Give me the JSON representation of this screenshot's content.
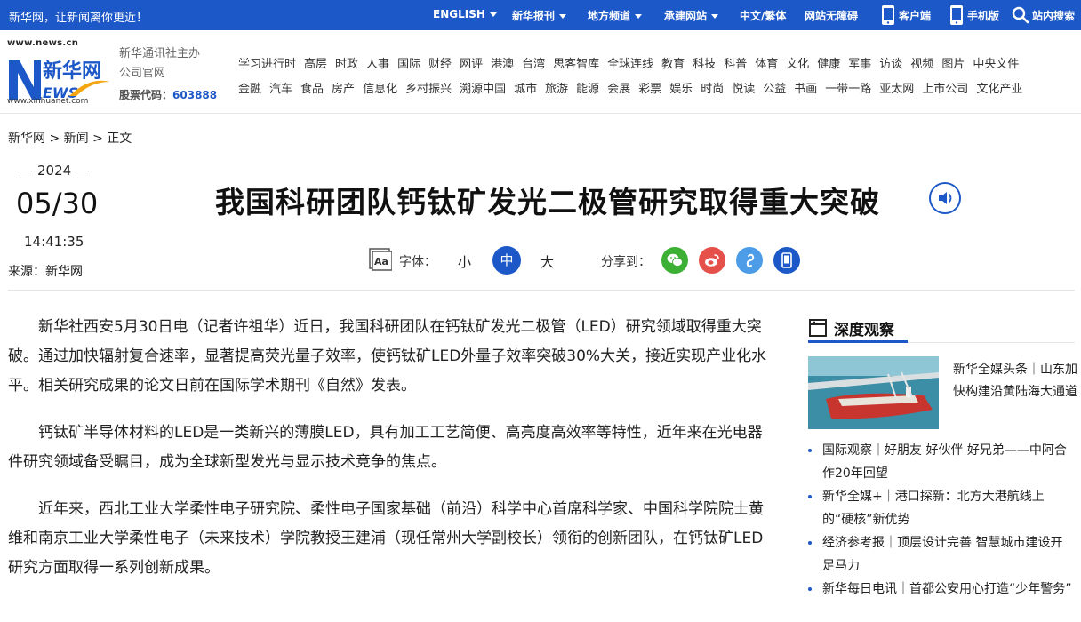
{
  "topbar": {
    "slogan": "新华网，让新闻离你更近！",
    "english": "ENGLISH",
    "newspapers": "新华报刊",
    "regional": "地方频道",
    "affiliates": "承建网站",
    "zh_traditional": "中文/繁体",
    "accessibility": "网站无障碍",
    "client": "客户端",
    "mobile": "手机版",
    "site_search": "站内搜索"
  },
  "header": {
    "logo_url_top": "www.news.cn",
    "logo_url_bottom": "www.xinhuanet.com",
    "org_line1": "新华通讯社主办",
    "org_line2": "公司官网",
    "stock_label": "股票代码：",
    "stock_code": "603888",
    "nav_row1": [
      "学习进行时",
      "高层",
      "时政",
      "人事",
      "国际",
      "财经",
      "网评",
      "港澳",
      "台湾",
      "思客智库",
      "全球连线",
      "教育",
      "科技",
      "科普",
      "体育",
      "文化",
      "健康",
      "军事",
      "访谈",
      "视频",
      "图片",
      "中央文件"
    ],
    "nav_row2": [
      "金融",
      "汽车",
      "食品",
      "房产",
      "信息化",
      "乡村振兴",
      "溯源中国",
      "城市",
      "旅游",
      "能源",
      "会展",
      "彩票",
      "娱乐",
      "时尚",
      "悦读",
      "公益",
      "书画",
      "一带一路",
      "亚太网",
      "上市公司",
      "文化产业"
    ]
  },
  "breadcrumb": {
    "home": "新华网",
    "sep1": " > ",
    "section": "新闻",
    "sep2": " > ",
    "current": "正文"
  },
  "meta": {
    "year": "2024",
    "month_day": "05/30",
    "time": "14:41:35",
    "source": "来源：新华网"
  },
  "article": {
    "title": "我国科研团队钙钛矿发光二极管研究取得重大突破",
    "font_label": "字体：",
    "font_small": "小",
    "font_medium": "中",
    "font_large": "大",
    "share_label": "分享到：",
    "paragraphs": [
      "新华社西安5月30日电（记者许祖华）近日，我国科研团队在钙钛矿发光二极管（LED）研究领域取得重大突破。通过加快辐射复合速率，显著提高荧光量子效率，使钙钛矿LED外量子效率突破30%大关，接近实现产业化水平。相关研究成果的论文日前在国际学术期刊《自然》发表。",
      "钙钛矿半导体材料的LED是一类新兴的薄膜LED，具有加工工艺简便、高亮度高效率等特性，近年来在光电器件研究领域备受瞩目，成为全球新型发光与显示技术竞争的焦点。",
      "近年来，西北工业大学柔性电子研究院、柔性电子国家基础（前沿）科学中心首席科学家、中国科学院院士黄维和南京工业大学柔性电子（未来技术）学院教授王建浦（现任常州大学副校长）领衔的创新团队，在钙钛矿LED研究方面取得一系列创新成果。"
    ]
  },
  "sidebar": {
    "heading": "深度观察",
    "feature_text": "新华全媒头条｜山东加快构建沿黄陆海大通道",
    "items": [
      "国际观察｜好朋友 好伙伴 好兄弟——中阿合作20年回望",
      "新华全媒+｜港口探新：北方大港航线上的“硬核”新优势",
      "经济参考报｜顶层设计完善 智慧城市建设开足马力",
      "新华每日电讯｜首都公安用心打造“少年警务”"
    ]
  },
  "colors": {
    "brand_blue": "#1d58c8",
    "wechat": "#3cb034",
    "weibo": "#e5504a",
    "link": "#4c9ce8",
    "mobile": "#1d58c8"
  },
  "icons": [
    "globe-icon",
    "user-icon",
    "phone-icon",
    "search-icon",
    "speaker-icon",
    "font-size-icon",
    "wechat-icon",
    "weibo-icon",
    "link-icon",
    "mobile-icon",
    "book-icon"
  ]
}
